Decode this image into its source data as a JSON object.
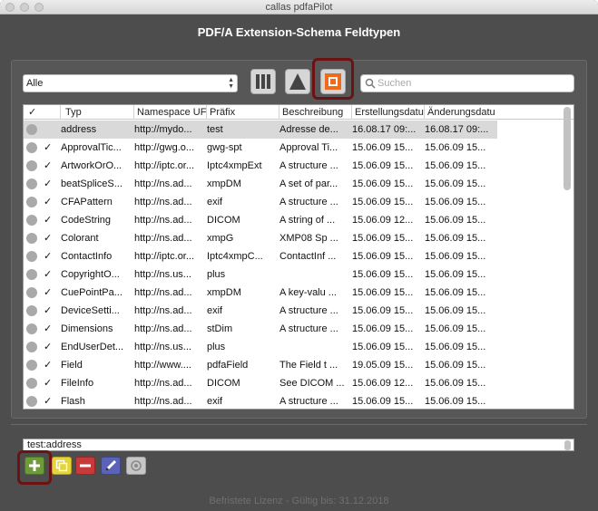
{
  "window": {
    "title": "callas pdfaPilot"
  },
  "header": {
    "title": "PDF/A Extension-Schema Feldtypen"
  },
  "toolbar": {
    "filter_value": "Alle",
    "buttons": [
      "columns-view-icon",
      "triangle-view-icon",
      "square-stop-icon"
    ],
    "search_placeholder": "Suchen"
  },
  "table": {
    "columns": [
      "",
      "✓",
      "Typ",
      "Namespace UF",
      "Präfix",
      "Beschreibung",
      "Erstellungsdatu",
      "Änderungsdatu"
    ],
    "rows": [
      {
        "check": "",
        "typ": "address",
        "ns": "http://mydo...",
        "prefix": "test",
        "desc": "Adresse de...",
        "created": "16.08.17 09:...",
        "modified": "16.08.17 09:...",
        "selected": true
      },
      {
        "check": "✓",
        "typ": "ApprovalTic...",
        "ns": "http://gwg.o...",
        "prefix": "gwg-spt",
        "desc": "Approval Ti...",
        "created": "15.06.09 15...",
        "modified": "15.06.09 15..."
      },
      {
        "check": "✓",
        "typ": "ArtworkOrO...",
        "ns": "http://iptc.or...",
        "prefix": "Iptc4xmpExt",
        "desc": "A structure ...",
        "created": "15.06.09 15...",
        "modified": "15.06.09 15..."
      },
      {
        "check": "✓",
        "typ": "beatSpliceS...",
        "ns": "http://ns.ad...",
        "prefix": "xmpDM",
        "desc": "A set of par...",
        "created": "15.06.09 15...",
        "modified": "15.06.09 15..."
      },
      {
        "check": "✓",
        "typ": "CFAPattern",
        "ns": "http://ns.ad...",
        "prefix": "exif",
        "desc": "A structure ...",
        "created": "15.06.09 15...",
        "modified": "15.06.09 15..."
      },
      {
        "check": "✓",
        "typ": "CodeString",
        "ns": "http://ns.ad...",
        "prefix": "DICOM",
        "desc": "A string of ...",
        "created": "15.06.09 12...",
        "modified": "15.06.09 15..."
      },
      {
        "check": "✓",
        "typ": "Colorant",
        "ns": "http://ns.ad...",
        "prefix": "xmpG",
        "desc": "XMP08 Sp ...",
        "created": "15.06.09 15...",
        "modified": "15.06.09 15..."
      },
      {
        "check": "✓",
        "typ": "ContactInfo",
        "ns": "http://iptc.or...",
        "prefix": "Iptc4xmpC...",
        "desc": "ContactInf ...",
        "created": "15.06.09 15...",
        "modified": "15.06.09 15..."
      },
      {
        "check": "✓",
        "typ": "CopyrightO...",
        "ns": "http://ns.us...",
        "prefix": "plus",
        "desc": "",
        "created": "15.06.09 15...",
        "modified": "15.06.09 15..."
      },
      {
        "check": "✓",
        "typ": "CuePointPa...",
        "ns": "http://ns.ad...",
        "prefix": "xmpDM",
        "desc": "A key-valu ...",
        "created": "15.06.09 15...",
        "modified": "15.06.09 15..."
      },
      {
        "check": "✓",
        "typ": "DeviceSetti...",
        "ns": "http://ns.ad...",
        "prefix": "exif",
        "desc": "A structure ...",
        "created": "15.06.09 15...",
        "modified": "15.06.09 15..."
      },
      {
        "check": "✓",
        "typ": "Dimensions",
        "ns": "http://ns.ad...",
        "prefix": "stDim",
        "desc": "A structure ...",
        "created": "15.06.09 15...",
        "modified": "15.06.09 15..."
      },
      {
        "check": "✓",
        "typ": "EndUserDet...",
        "ns": "http://ns.us...",
        "prefix": "plus",
        "desc": "",
        "created": "15.06.09 15...",
        "modified": "15.06.09 15..."
      },
      {
        "check": "✓",
        "typ": "Field",
        "ns": "http://www....",
        "prefix": "pdfaField",
        "desc": "The Field t ...",
        "created": "19.05.09 15...",
        "modified": "15.06.09 15..."
      },
      {
        "check": "✓",
        "typ": "FileInfo",
        "ns": "http://ns.ad...",
        "prefix": "DICOM",
        "desc": "See DICOM ...",
        "created": "15.06.09 12...",
        "modified": "15.06.09 15..."
      },
      {
        "check": "✓",
        "typ": "Flash",
        "ns": "http://ns.ad...",
        "prefix": "exif",
        "desc": "A structure ...",
        "created": "15.06.09 15...",
        "modified": "15.06.09 15..."
      }
    ]
  },
  "detail": {
    "value": "test:address"
  },
  "actions": {
    "buttons": [
      {
        "name": "add-button",
        "icon": "plus-icon",
        "color": "#6e9a3a"
      },
      {
        "name": "duplicate-button",
        "icon": "duplicate-icon",
        "color": "#e5d53a"
      },
      {
        "name": "remove-button",
        "icon": "minus-icon",
        "color": "#c83a3a"
      },
      {
        "name": "edit-button",
        "icon": "pencil-icon",
        "color": "#5a63b5"
      },
      {
        "name": "reset-button",
        "icon": "reset-icon",
        "color": "#c7c7c7"
      }
    ]
  },
  "footer": {
    "license": "Befristete Lizenz - Gültig bis: 31.12.2018"
  },
  "colors": {
    "window_bg": "#4d4d4d",
    "highlight": "#6d1212",
    "stop_accent": "#ee6a1c"
  }
}
